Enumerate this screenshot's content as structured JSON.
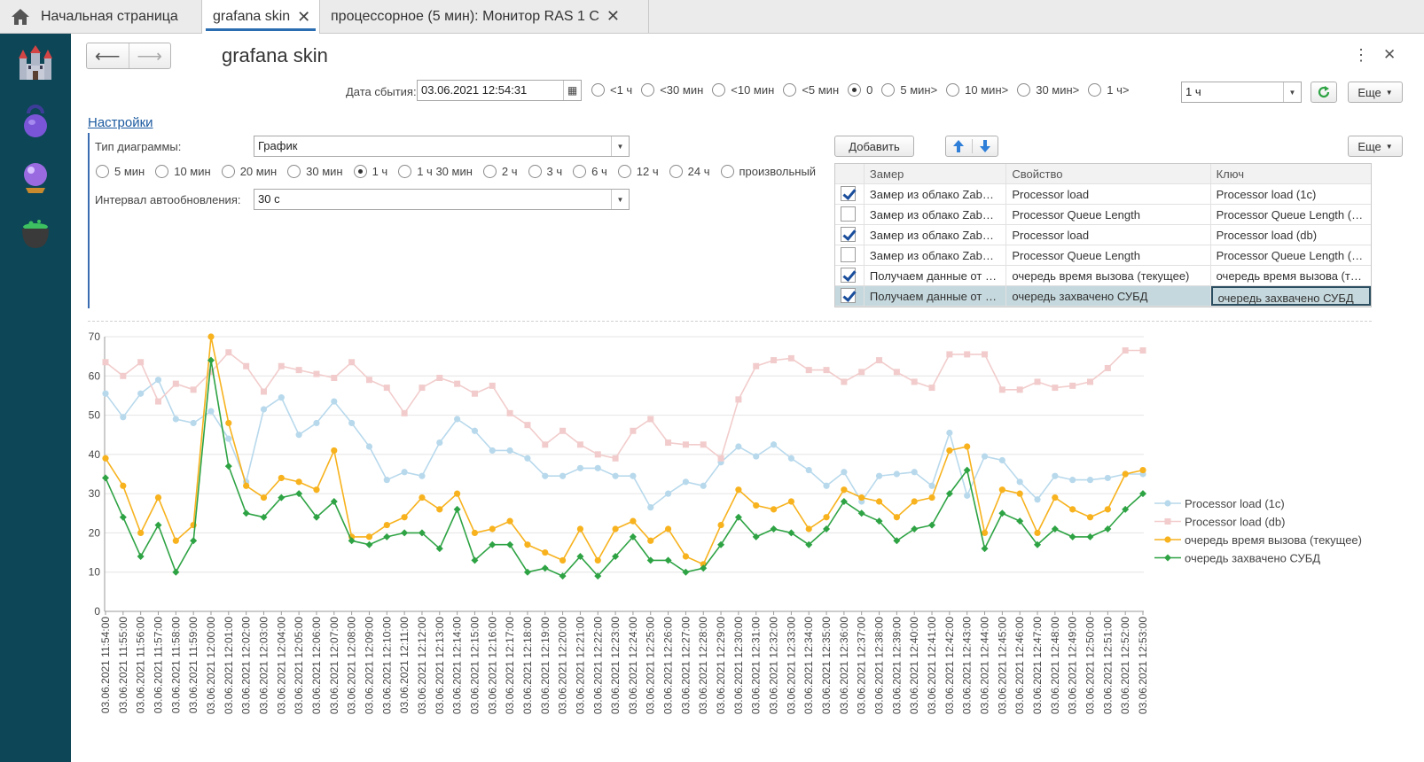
{
  "tabs": [
    {
      "label": "Начальная страница"
    },
    {
      "label": "grafana skin"
    },
    {
      "label": "процессорное (5 мин): Монитор RAS 1 C"
    }
  ],
  "sidebar": {
    "icons": [
      "castle-icon",
      "kettlebell-icon",
      "crystal-ball-icon",
      "cauldron-icon"
    ]
  },
  "form": {
    "title": "grafana skin",
    "date_label": "Дата сбытия:",
    "date_value": "03.06.2021 12:54:31",
    "offsets": [
      {
        "label": "<1 ч",
        "selected": false
      },
      {
        "label": "<30 мин",
        "selected": false
      },
      {
        "label": "<10 мин",
        "selected": false
      },
      {
        "label": "<5 мин",
        "selected": false
      },
      {
        "label": "0",
        "selected": true
      },
      {
        "label": "5 мин>",
        "selected": false
      },
      {
        "label": "10 мин>",
        "selected": false
      },
      {
        "label": "30 мин>",
        "selected": false
      },
      {
        "label": "1 ч>",
        "selected": false
      }
    ],
    "step_value": "1 ч",
    "more_label": "Еще"
  },
  "settings": {
    "link": "Настройки",
    "chart_type_label": "Тип диаграммы:",
    "chart_type_value": "График",
    "periods": [
      {
        "label": "5 мин",
        "selected": false
      },
      {
        "label": "10 мин",
        "selected": false
      },
      {
        "label": "20 мин",
        "selected": false
      },
      {
        "label": "30 мин",
        "selected": false
      },
      {
        "label": "1 ч",
        "selected": true
      },
      {
        "label": "1 ч 30 мин",
        "selected": false
      },
      {
        "label": "2 ч",
        "selected": false
      },
      {
        "label": "3 ч",
        "selected": false
      },
      {
        "label": "6 ч",
        "selected": false
      },
      {
        "label": "12 ч",
        "selected": false
      },
      {
        "label": "24 ч",
        "selected": false
      },
      {
        "label": "произвольный",
        "selected": false
      }
    ],
    "refresh_label": "Интервал автообновления:",
    "refresh_value": "30 с"
  },
  "table": {
    "add_label": "Добавить",
    "more_label": "Еще",
    "columns": [
      "Замер",
      "Свойство",
      "Ключ"
    ],
    "rows": [
      {
        "checked": true,
        "measure": "Замер из облако Zab…",
        "property": "Processor load",
        "key": "Processor load (1c)"
      },
      {
        "checked": false,
        "measure": "Замер из облако Zab…",
        "property": "Processor Queue Length",
        "key": "Processor Queue Length (1c)"
      },
      {
        "checked": true,
        "measure": "Замер из облако Zab…",
        "property": "Processor load",
        "key": "Processor load (db)"
      },
      {
        "checked": false,
        "measure": "Замер из облако Zab…",
        "property": "Processor Queue Length",
        "key": "Processor Queue Length (db)"
      },
      {
        "checked": true,
        "measure": "Получаем данные от …",
        "property": "очередь время вызова (текущее)",
        "key": "очередь время вызова (т…"
      },
      {
        "checked": true,
        "measure": "Получаем данные от …",
        "property": "очередь захвачено СУБД",
        "key": "очередь захвачено СУБД",
        "selected": true
      }
    ]
  },
  "chart_data": {
    "type": "line",
    "ylim": [
      0,
      70
    ],
    "yticks": [
      0,
      10,
      20,
      30,
      40,
      50,
      60,
      70
    ],
    "categories": [
      "03.06.2021 11:54:00",
      "03.06.2021 11:55:00",
      "03.06.2021 11:56:00",
      "03.06.2021 11:57:00",
      "03.06.2021 11:58:00",
      "03.06.2021 11:59:00",
      "03.06.2021 12:00:00",
      "03.06.2021 12:01:00",
      "03.06.2021 12:02:00",
      "03.06.2021 12:03:00",
      "03.06.2021 12:04:00",
      "03.06.2021 12:05:00",
      "03.06.2021 12:06:00",
      "03.06.2021 12:07:00",
      "03.06.2021 12:08:00",
      "03.06.2021 12:09:00",
      "03.06.2021 12:10:00",
      "03.06.2021 12:11:00",
      "03.06.2021 12:12:00",
      "03.06.2021 12:13:00",
      "03.06.2021 12:14:00",
      "03.06.2021 12:15:00",
      "03.06.2021 12:16:00",
      "03.06.2021 12:17:00",
      "03.06.2021 12:18:00",
      "03.06.2021 12:19:00",
      "03.06.2021 12:20:00",
      "03.06.2021 12:21:00",
      "03.06.2021 12:22:00",
      "03.06.2021 12:23:00",
      "03.06.2021 12:24:00",
      "03.06.2021 12:25:00",
      "03.06.2021 12:26:00",
      "03.06.2021 12:27:00",
      "03.06.2021 12:28:00",
      "03.06.2021 12:29:00",
      "03.06.2021 12:30:00",
      "03.06.2021 12:31:00",
      "03.06.2021 12:32:00",
      "03.06.2021 12:33:00",
      "03.06.2021 12:34:00",
      "03.06.2021 12:35:00",
      "03.06.2021 12:36:00",
      "03.06.2021 12:37:00",
      "03.06.2021 12:38:00",
      "03.06.2021 12:39:00",
      "03.06.2021 12:40:00",
      "03.06.2021 12:41:00",
      "03.06.2021 12:42:00",
      "03.06.2021 12:43:00",
      "03.06.2021 12:44:00",
      "03.06.2021 12:45:00",
      "03.06.2021 12:46:00",
      "03.06.2021 12:47:00",
      "03.06.2021 12:48:00",
      "03.06.2021 12:49:00",
      "03.06.2021 12:50:00",
      "03.06.2021 12:51:00",
      "03.06.2021 12:52:00",
      "03.06.2021 12:53:00"
    ],
    "series": [
      {
        "name": "Processor load (1c)",
        "color": "#b8d9ec",
        "marker": "circle",
        "values": [
          55.5,
          49.5,
          55.5,
          59,
          49,
          48,
          51,
          44,
          33,
          51.5,
          54.5,
          45,
          48,
          53.5,
          48,
          42,
          33.5,
          35.5,
          34.5,
          43,
          49,
          46,
          41,
          41,
          39,
          34.5,
          34.5,
          36.5,
          36.5,
          34.5,
          34.5,
          26.5,
          30,
          33,
          32,
          38,
          42,
          39.5,
          42.5,
          39,
          36,
          32,
          35.5,
          28,
          34.5,
          35,
          35.5,
          32,
          45.5,
          29.5,
          39.5,
          38.5,
          33,
          28.5,
          34.5,
          33.5,
          33.5,
          34,
          35,
          35
        ]
      },
      {
        "name": "Processor load (db)",
        "color": "#f2cccc",
        "marker": "square",
        "values": [
          63.5,
          60,
          63.5,
          53.5,
          58,
          56.5,
          61,
          66,
          62.5,
          56,
          62.5,
          61.5,
          60.5,
          59.5,
          63.5,
          59,
          57,
          50.5,
          57,
          59.5,
          58,
          55.5,
          57.5,
          50.5,
          47.5,
          42.5,
          46,
          42.5,
          40,
          39,
          46,
          49,
          43,
          42.5,
          42.5,
          39,
          54,
          62.5,
          64,
          64.5,
          61.5,
          61.5,
          58.5,
          61,
          64,
          61,
          58.5,
          57,
          65.5,
          65.5,
          65.5,
          56.5,
          56.5,
          58.5,
          57,
          57.5,
          58.5,
          62,
          66.5,
          66.5
        ]
      },
      {
        "name": "очередь время вызова (текущее)",
        "color": "#f7b21e",
        "marker": "circle",
        "values": [
          39,
          32,
          20,
          29,
          18,
          22,
          70,
          48,
          32,
          29,
          34,
          33,
          31,
          41,
          19,
          19,
          22,
          24,
          29,
          26,
          30,
          20,
          21,
          23,
          17,
          15,
          13,
          21,
          13,
          21,
          23,
          18,
          21,
          14,
          12,
          22,
          31,
          27,
          26,
          28,
          21,
          24,
          31,
          29,
          28,
          24,
          28,
          29,
          41,
          42,
          20,
          31,
          30,
          20,
          29,
          26,
          24,
          26,
          35,
          36
        ]
      },
      {
        "name": "очередь захвачено СУБД",
        "color": "#2ea344",
        "marker": "diamond",
        "values": [
          34,
          24,
          14,
          22,
          10,
          18,
          64,
          37,
          25,
          24,
          29,
          30,
          24,
          28,
          18,
          17,
          19,
          20,
          20,
          16,
          26,
          13,
          17,
          17,
          10,
          11,
          9,
          14,
          9,
          14,
          19,
          13,
          13,
          10,
          11,
          17,
          24,
          19,
          21,
          20,
          17,
          21,
          28,
          25,
          23,
          18,
          21,
          22,
          30,
          36,
          16,
          25,
          23,
          17,
          21,
          19,
          19,
          21,
          26,
          30
        ]
      }
    ]
  }
}
